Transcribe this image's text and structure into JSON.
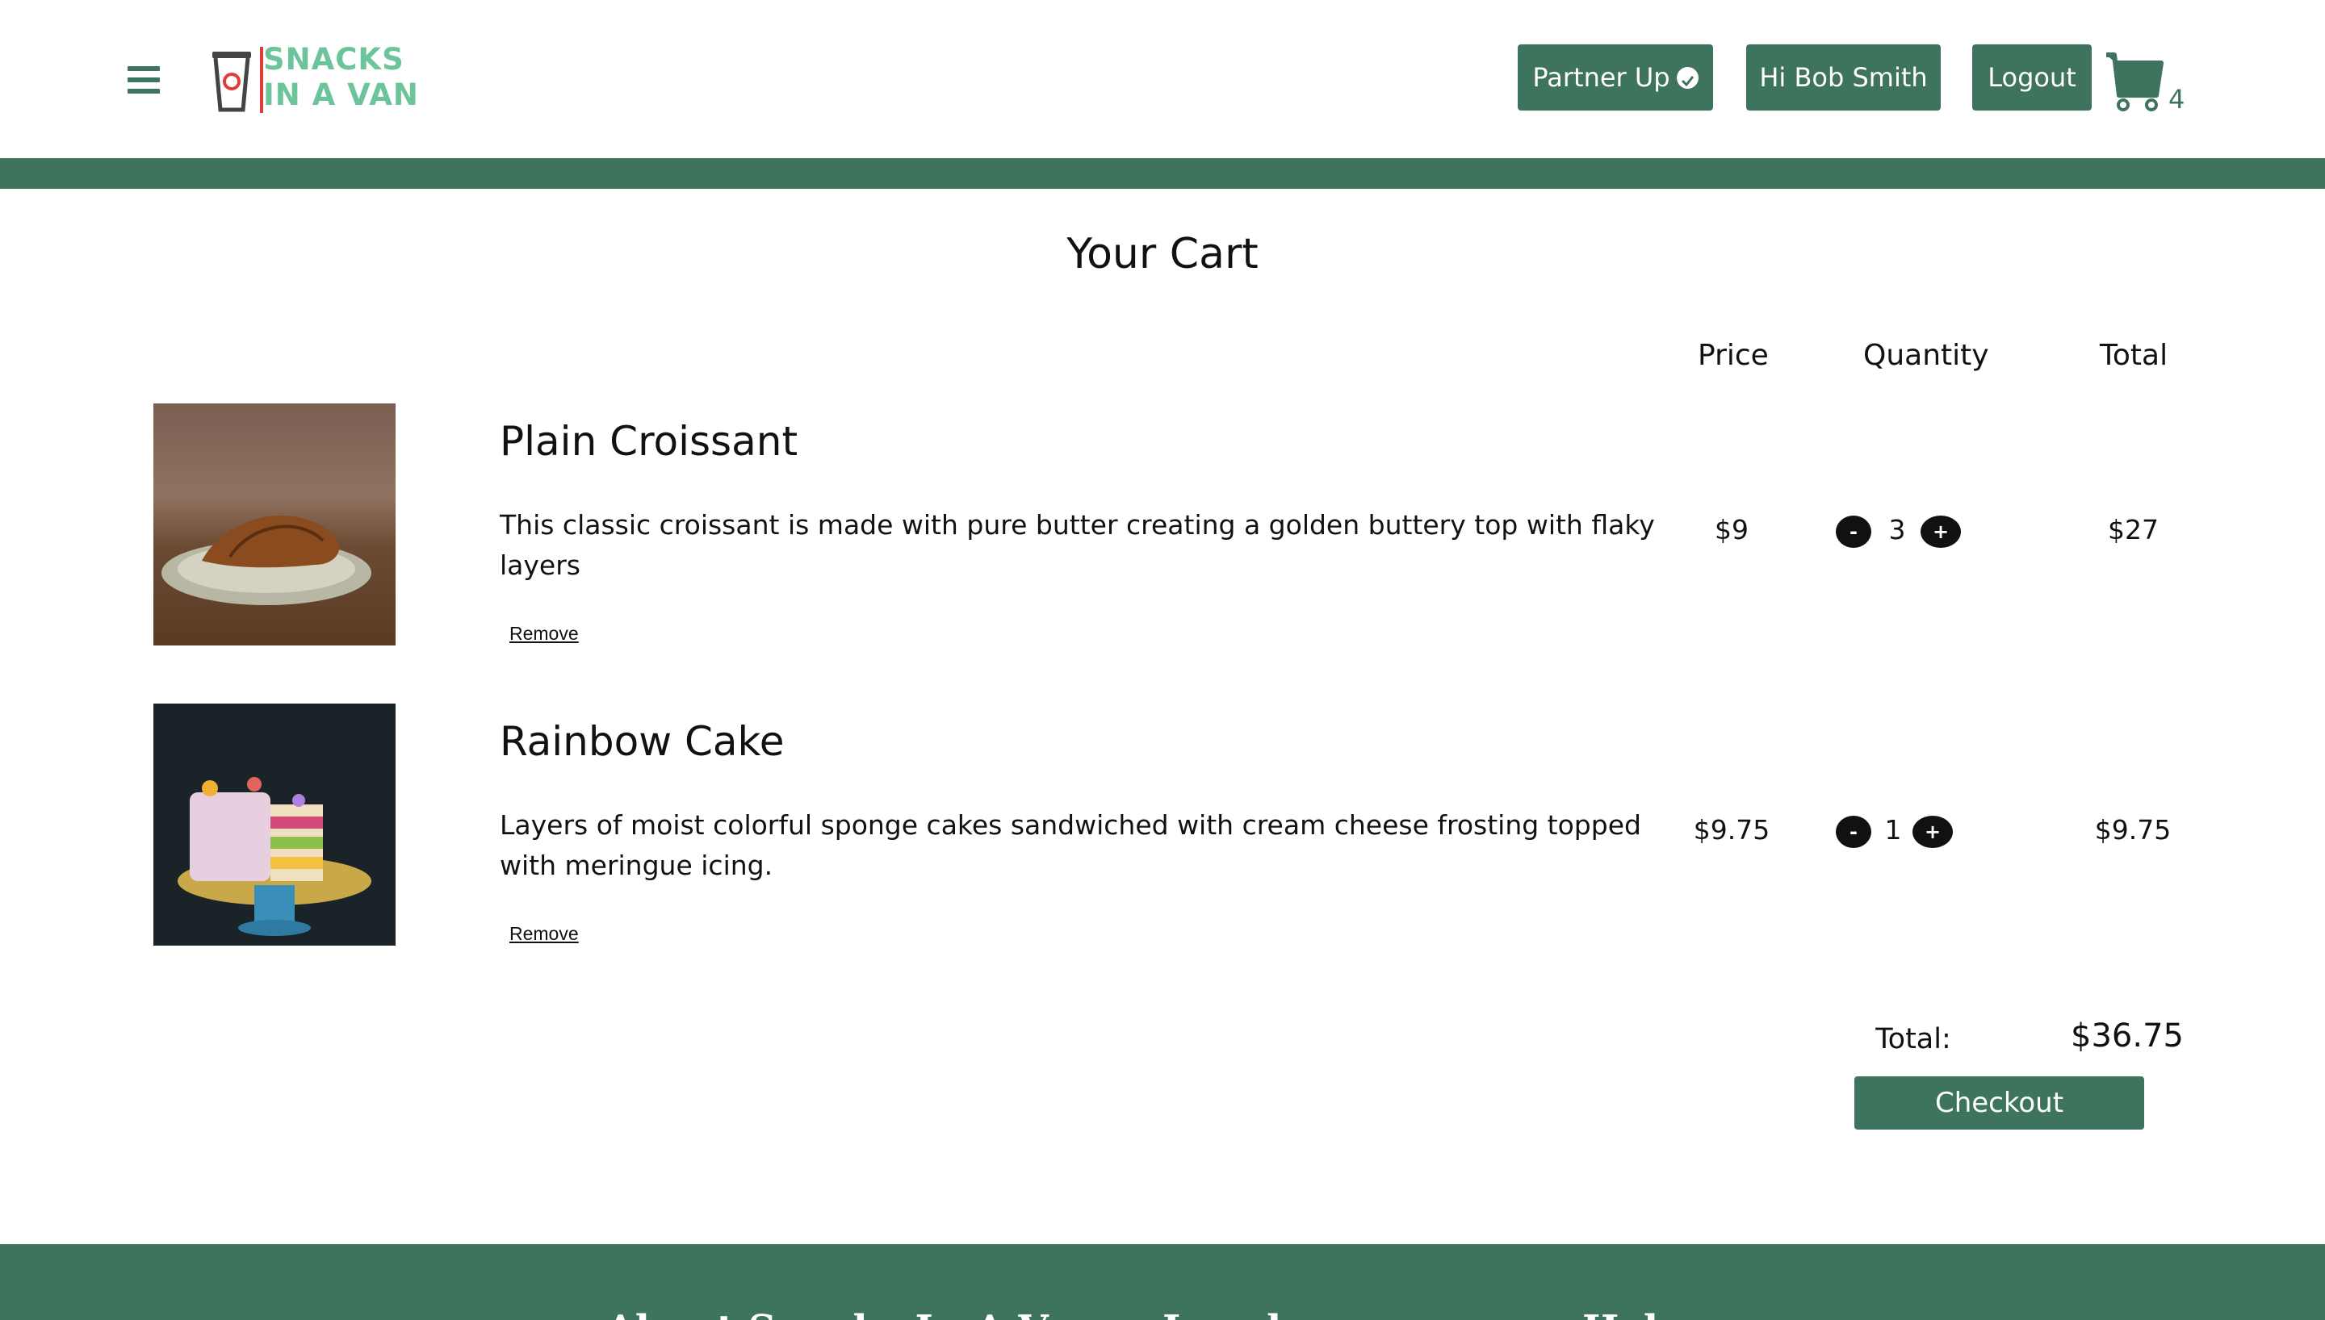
{
  "header": {
    "logo_text_line1": "SNACKS",
    "logo_text_line2": "IN A VAN",
    "partner_label": "Partner Up",
    "greeting": "Hi Bob Smith",
    "logout_label": "Logout",
    "cart_count": "4"
  },
  "cart": {
    "title": "Your Cart",
    "columns": {
      "price": "Price",
      "quantity": "Quantity",
      "total": "Total"
    },
    "items": [
      {
        "name": "Plain Croissant",
        "description": "This classic croissant is made with pure butter creating a golden buttery top with flaky layers",
        "remove_label": "Remove",
        "price": "$9",
        "quantity": "3",
        "total": "$27",
        "minus": "-",
        "plus": "+"
      },
      {
        "name": "Rainbow Cake",
        "description": "Layers of moist colorful sponge cakes sandwiched with cream cheese frosting topped with meringue icing.",
        "remove_label": "Remove",
        "price": "$9.75",
        "quantity": "1",
        "total": "$9.75",
        "minus": "-",
        "plus": "+"
      }
    ],
    "total_label": "Total:",
    "total_value": "$36.75",
    "checkout_label": "Checkout"
  },
  "footer": {
    "col1": "About Snacks In A Van",
    "col2": "Legal",
    "col3": "Help"
  },
  "colors": {
    "brand_green": "#3e735d",
    "logo_green": "#6cc49a",
    "logo_red": "#e03c3c"
  }
}
